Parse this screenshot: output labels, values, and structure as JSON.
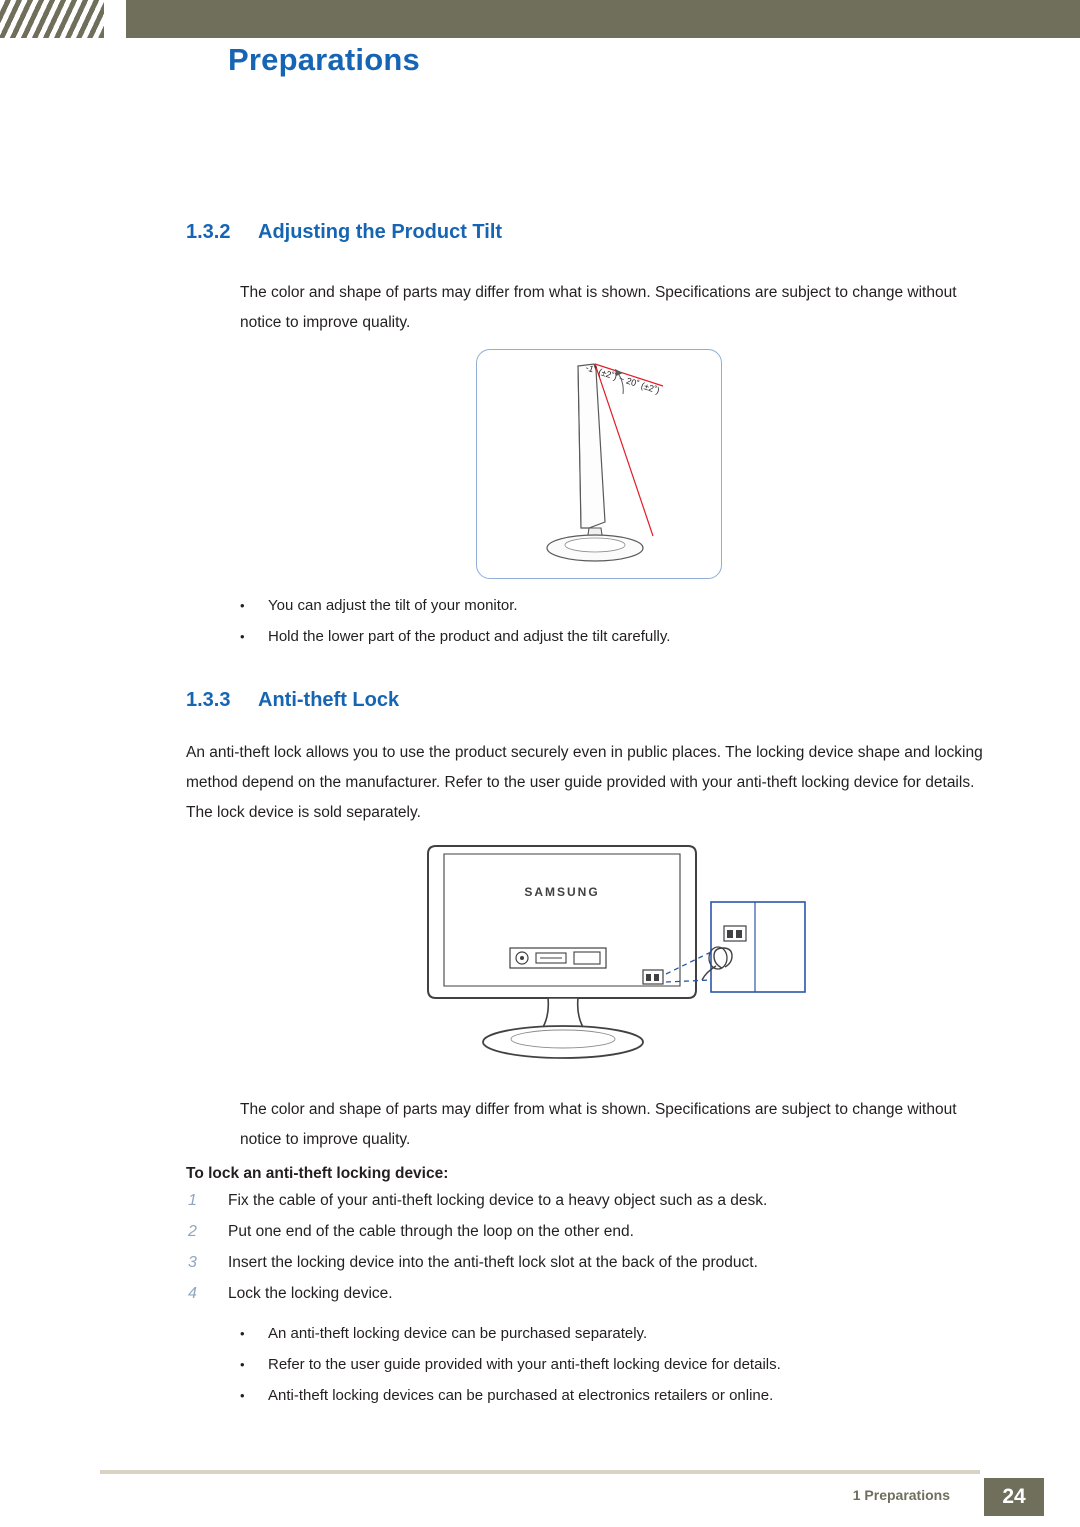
{
  "header": {
    "title": "Preparations"
  },
  "sections": [
    {
      "number": "1.3.2",
      "title": "Adjusting the Product Tilt",
      "paragraph": "The color and shape of parts may differ from what is shown. Specifications are subject to change without notice to improve quality.",
      "figure": {
        "name": "monitor-tilt-diagram",
        "angle_label": "-1˚ (±2˚) ~ 20˚ (±2˚)"
      },
      "bullets": [
        "You can adjust the tilt of your monitor.",
        "Hold the lower part of the product and adjust the tilt carefully."
      ]
    },
    {
      "number": "1.3.3",
      "title": "Anti-theft Lock",
      "paragraph": "An anti-theft lock allows you to use the product securely even in public places. The locking device shape and locking method depend on the manufacturer. Refer to the user guide provided with your anti-theft locking device for details. The lock device is sold separately.",
      "figure": {
        "name": "monitor-rear-antitheft-diagram",
        "brand": "SAMSUNG"
      },
      "note": "The color and shape of parts may differ from what is shown. Specifications are subject to change without notice to improve quality.",
      "procedure_title": "To lock an anti-theft locking device:",
      "steps": [
        {
          "number": "1",
          "text": "Fix the cable of your anti-theft locking device to a heavy object such as a desk."
        },
        {
          "number": "2",
          "text": "Put one end of the cable through the loop on the other end."
        },
        {
          "number": "3",
          "text": "Insert the locking device into the anti-theft lock slot at the back of the product."
        },
        {
          "number": "4",
          "text": "Lock the locking device."
        }
      ],
      "bullets": [
        "An anti-theft locking device can be purchased separately.",
        "Refer to the user guide provided with your anti-theft locking device for details.",
        "Anti-theft locking devices can be purchased at electronics retailers or online."
      ]
    }
  ],
  "footer": {
    "chapter": "1 Preparations",
    "page_number": "24"
  },
  "colors": {
    "heading_blue": "#1665b4",
    "band_olive": "#6f6f5c",
    "rule_tan": "#d8d3c4",
    "step_number": "#8fa6c2"
  },
  "bullet_glyph": "•"
}
